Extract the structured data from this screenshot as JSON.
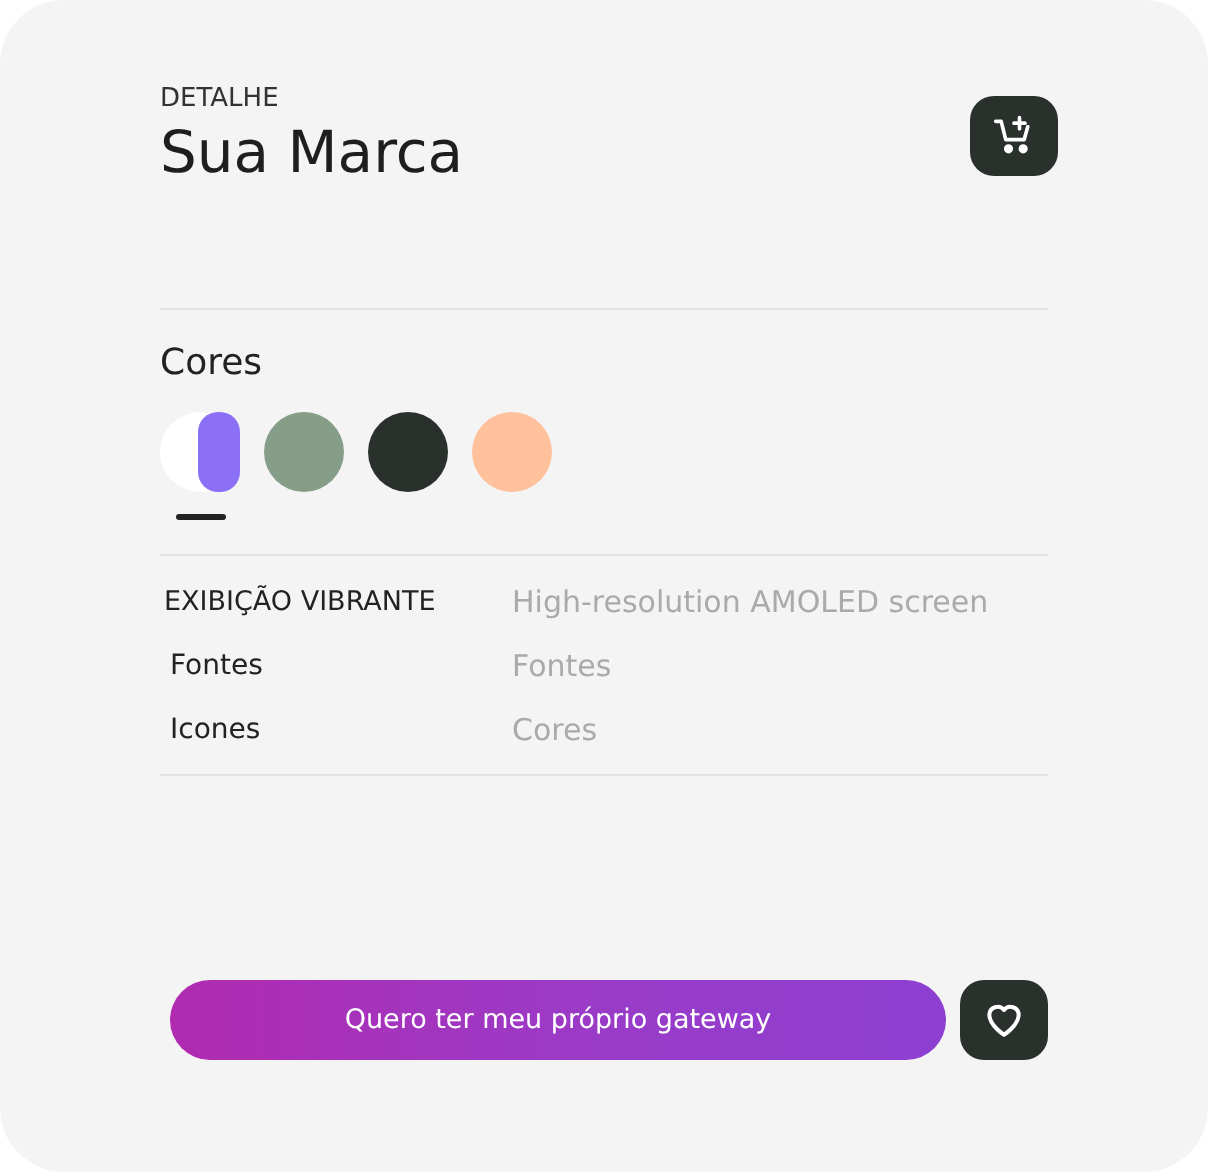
{
  "header": {
    "eyebrow": "DETALHE",
    "title": "Sua Marca"
  },
  "colors": {
    "label": "Cores",
    "swatches": [
      {
        "kind": "split",
        "color": "#ffffff",
        "accent": {
          "color": "#8b6ff5"
        },
        "selected": true
      },
      {
        "kind": "solid",
        "color": "#869d88",
        "selected": false
      },
      {
        "kind": "solid",
        "color": "#2a302b",
        "selected": false
      },
      {
        "kind": "solid",
        "color": "#fec19c",
        "selected": false
      }
    ]
  },
  "specs": [
    {
      "name": "EXIBIÇÃO VIBRANTE",
      "value": "High-resolution AMOLED screen"
    },
    {
      "name": "Fontes",
      "value": "Fontes"
    },
    {
      "name": "Icones",
      "value": "Cores"
    }
  ],
  "cta": {
    "label": "Quero ter meu próprio gateway"
  }
}
